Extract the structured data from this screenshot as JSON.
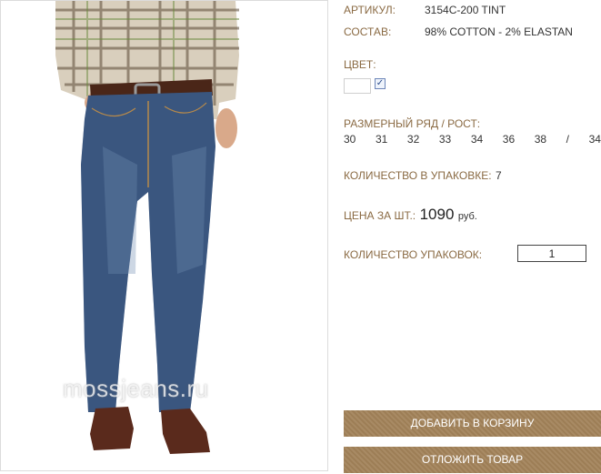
{
  "product": {
    "article_label": "АРТИКУЛ:",
    "article_value": "3154C-200 TINT",
    "composition_label": "СОСТАВ:",
    "composition_value": "98% COTTON - 2% ELASTAN",
    "color_label": "ЦВЕТ:",
    "color_checked": "✓",
    "sizes_label": "РАЗМЕРНЫЙ РЯД / РОСТ:",
    "sizes": [
      "30",
      "31",
      "32",
      "33",
      "34",
      "36",
      "38",
      "/",
      "34"
    ],
    "pack_qty_label": "КОЛИЧЕСТВО В УПАКОВКЕ:",
    "pack_qty_value": "7",
    "price_label": "ЦЕНА ЗА ШТ.:",
    "price_value": "1090",
    "price_currency": "руб.",
    "packs_label": "КОЛИЧЕСТВО УПАКОВОК:",
    "packs_value": "1"
  },
  "buttons": {
    "add_to_cart": "ДОБАВИТЬ В КОРЗИНУ",
    "postpone": "ОТЛОЖИТЬ ТОВАР"
  },
  "image": {
    "watermark": "mossjeans.ru"
  },
  "colors": {
    "label": "#8a6a43",
    "button": "#a3835a",
    "denim": "#2f4a72"
  }
}
